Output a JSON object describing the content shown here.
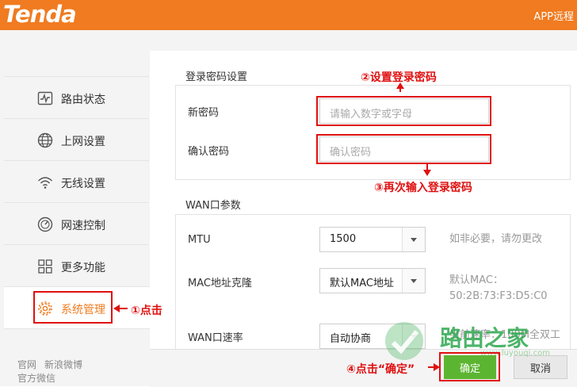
{
  "header": {
    "logo": "Tenda",
    "app_link": "APP远程"
  },
  "sidebar": {
    "items": [
      {
        "label": "路由状态",
        "icon": "pulse-monitor-icon"
      },
      {
        "label": "上网设置",
        "icon": "globe-icon"
      },
      {
        "label": "无线设置",
        "icon": "wifi-icon"
      },
      {
        "label": "网速控制",
        "icon": "speedometer-icon"
      },
      {
        "label": "更多功能",
        "icon": "grid-icon"
      },
      {
        "label": "系统管理",
        "icon": "gear-icon"
      }
    ],
    "links": [
      "官网",
      "新浪微博",
      "官方微信"
    ]
  },
  "login_password": {
    "title": "登录密码设置",
    "new_label": "新密码",
    "new_placeholder": "请输入数字或字母",
    "confirm_label": "确认密码",
    "confirm_placeholder": "确认密码"
  },
  "wan": {
    "title": "WAN口参数",
    "mtu_label": "MTU",
    "mtu_value": "1500",
    "mtu_hint": "如非必要，请勿更改",
    "mac_label": "MAC地址克隆",
    "mac_value": "默认MAC地址",
    "mac_hint_prefix": "默认MAC：",
    "mac_hint_value": "50:2B:73:F3:D5:C0",
    "speed_label": "WAN口速率",
    "speed_value": "自动协商",
    "speed_hint": "当前速率：100M全双工"
  },
  "footer": {
    "ok_label": "确定",
    "cancel_label": "取消"
  },
  "annotations": {
    "step1": "①点击",
    "step2": "②设置登录密码",
    "step3": "③再次输入登录密码",
    "step4": "④点击“确定”"
  },
  "watermark": {
    "text": "路由之家",
    "url": "www.luyouqi.com"
  },
  "colors": {
    "brand": "#f07b20",
    "annotation": "#e01010",
    "ok_button": "#5cb531"
  }
}
